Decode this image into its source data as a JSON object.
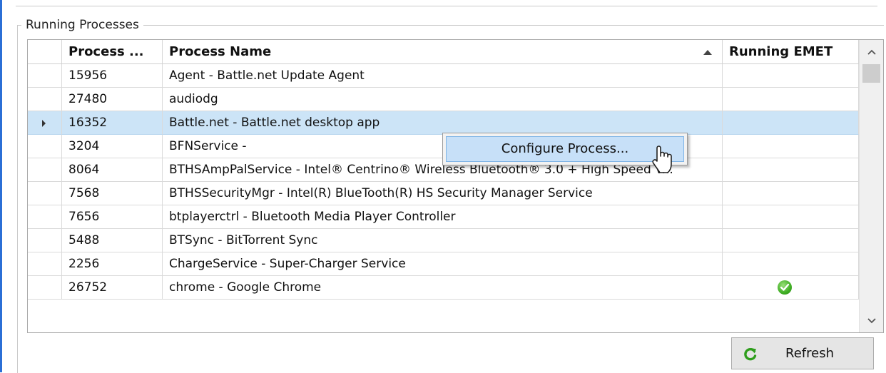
{
  "group": {
    "title": "Running Processes"
  },
  "table": {
    "columns": [
      "Process ...",
      "Process Name",
      "Running EMET"
    ],
    "sorted_column": "Process Name",
    "sort_direction": "ascending",
    "rows": [
      {
        "pid": "15956",
        "name": "Agent - Battle.net Update Agent",
        "emet": false,
        "selected": false
      },
      {
        "pid": "27480",
        "name": "audiodg",
        "emet": false,
        "selected": false
      },
      {
        "pid": "16352",
        "name": "Battle.net - Battle.net desktop app",
        "emet": false,
        "selected": true
      },
      {
        "pid": "3204",
        "name": "BFNService -",
        "emet": false,
        "selected": false
      },
      {
        "pid": "8064",
        "name": "BTHSAmpPalService - Intel® Centrino® Wireless Bluetooth® 3.0 + High Speed V...",
        "emet": false,
        "selected": false
      },
      {
        "pid": "7568",
        "name": "BTHSSecurityMgr - Intel(R) BlueTooth(R) HS Security Manager Service",
        "emet": false,
        "selected": false
      },
      {
        "pid": "7656",
        "name": "btplayerctrl - Bluetooth Media Player Controller",
        "emet": false,
        "selected": false
      },
      {
        "pid": "5488",
        "name": "BTSync - BitTorrent Sync",
        "emet": false,
        "selected": false
      },
      {
        "pid": "2256",
        "name": "ChargeService - Super-Charger Service",
        "emet": false,
        "selected": false
      },
      {
        "pid": "26752",
        "name": "chrome - Google Chrome",
        "emet": true,
        "selected": false
      }
    ]
  },
  "context_menu": {
    "items": [
      "Configure Process..."
    ]
  },
  "buttons": {
    "refresh": "Refresh"
  },
  "colors": {
    "selection": "#cce4f7",
    "menu_highlight": "#c7e0f8",
    "check_green": "#3fae23",
    "refresh_green": "#2f9e1d"
  },
  "icons": {
    "sort": "sort-ascending-icon",
    "emet": "checkmark-circle-icon",
    "refresh": "refresh-icon",
    "scroll_up": "chevron-up-icon",
    "scroll_down": "chevron-down-icon"
  }
}
